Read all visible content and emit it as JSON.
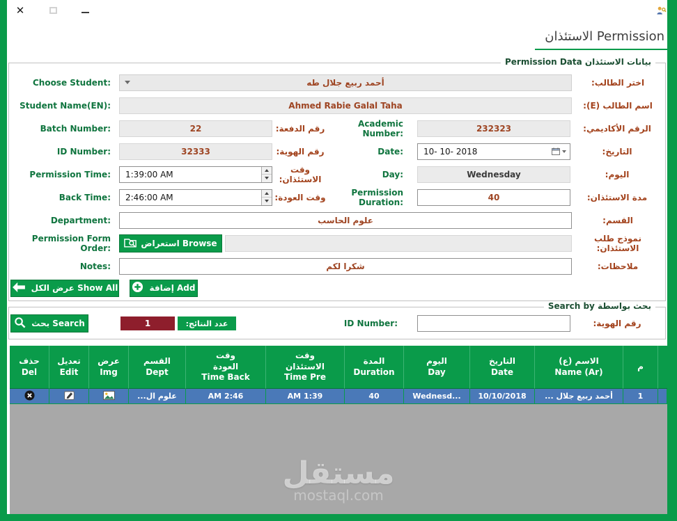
{
  "window": {
    "close_glyph": "✕",
    "title": "الاستئذان Permission"
  },
  "form": {
    "group_title": "Permission Data بيانات الاستئذان",
    "choose_student": {
      "en": "Choose Student:",
      "ar": "اختر الطالب:",
      "value": "أحمد ربيع جلال طه"
    },
    "student_name": {
      "en": "Student Name(EN):",
      "ar": "اسم الطالب (E):",
      "value": "Ahmed Rabie Galal Taha"
    },
    "batch_number": {
      "en": "Batch Number:",
      "ar": "رقم الدفعة:",
      "value": "22"
    },
    "academic_number": {
      "en": "Academic Number:",
      "ar": "الرقم الأكاديمي:",
      "value": "232323"
    },
    "id_number": {
      "en": "ID Number:",
      "ar": "رقم الهوية:",
      "value": "32333"
    },
    "date": {
      "en": "Date:",
      "ar": "التاريخ:",
      "value": "10- 10- 2018"
    },
    "permission_time": {
      "en": "Permission Time:",
      "ar": "وقت الاستئذان:",
      "value": "1:39:00 AM"
    },
    "day": {
      "en": "Day:",
      "ar": "اليوم:",
      "value": "Wednesday"
    },
    "back_time": {
      "en": "Back Time:",
      "ar": "وقت العودة:",
      "value": "2:46:00 AM"
    },
    "permission_duration": {
      "en": "Permission Duration:",
      "ar": "مدة الاستئذان:",
      "value": "40"
    },
    "department": {
      "en": "Department:",
      "ar": "القسم:",
      "value": "علوم الحاسب"
    },
    "permission_form": {
      "en": "Permission Form Order:",
      "ar": "نموذج طلب الاستئذان:",
      "browse": "استعراض Browse",
      "value": ""
    },
    "notes": {
      "en": "Notes:",
      "ar": "ملاحظات:",
      "value": "شكرا لكم"
    },
    "show_all_button": "عرض الكل Show All",
    "add_button": "إضافة Add"
  },
  "search": {
    "group_title": "Search by بحث بواسطة",
    "search_button": "بحث Search",
    "results_count": "1",
    "results_label": "عدد النتائج:",
    "id_number": {
      "en": "ID Number:",
      "ar": "رقم الهوية:",
      "value": ""
    }
  },
  "table": {
    "columns": [
      {
        "ar": "حذف",
        "en": "Del"
      },
      {
        "ar": "تعديل",
        "en": "Edit"
      },
      {
        "ar": "عرض",
        "en": "Img"
      },
      {
        "ar": "القسم",
        "en": "Dept"
      },
      {
        "ar": "وقت العودة",
        "en": "Time Back"
      },
      {
        "ar": "وقت الاستئذان",
        "en": "Time Pre"
      },
      {
        "ar": "المدة",
        "en": "Duration"
      },
      {
        "ar": "اليوم",
        "en": "Day"
      },
      {
        "ar": "التاريخ",
        "en": "Date"
      },
      {
        "ar": "الاسم (ع)",
        "en": "Name (Ar)"
      },
      {
        "ar": "م",
        "en": ""
      }
    ],
    "rows": [
      {
        "dept": "علوم ال...",
        "time_back": "AM 2:46",
        "time_pre": "AM 1:39",
        "duration": "40",
        "day": "Wednesd...",
        "date": "10/10/2018",
        "name_ar": "أحمد ربيع جلال ...",
        "index": "1"
      }
    ]
  },
  "watermark": {
    "title": "مستقل",
    "subtitle": "mostaql.com"
  },
  "colors": {
    "accent_green": "#0a9b4a",
    "count_red": "#8e1e2c",
    "selected_row_blue": "#4a79b8",
    "label_green": "#10753f",
    "label_red": "#a3431d"
  }
}
